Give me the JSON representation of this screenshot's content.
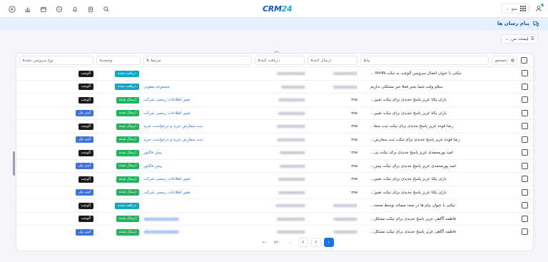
{
  "header": {
    "logo_main": "CRM",
    "logo_sub": "24",
    "app_switch_label": "منو"
  },
  "page": {
    "title": "پیام رسان ها",
    "filter_label": "لیست من"
  },
  "table": {
    "search_label": "جستجو",
    "columns": [
      "پیام",
      "ارسال کننده",
      "دریافت کننده",
      "مرتبط با",
      "وضعیت",
      "نوع سرویس دهنده"
    ],
    "rows": [
      {
        "message": "تیکتی با عنوان اتصال سرویس آلوچت به تیکت N۷۹N ...",
        "sender": "",
        "receiver_w": 40,
        "related": "",
        "status": "دریافت شده",
        "status_color": "#11a7c2",
        "type": "آلوچت",
        "type_color": "#1b1b1b"
      },
      {
        "message": "سلام وقت شما بخیر فعلا خبر مشکلی نداریم",
        "sender": "",
        "receiver_w": 34,
        "related": "مجموعه یعقوبی",
        "status": "دریافت شده",
        "status_color": "#11a7c2",
        "type": "آلوچت",
        "type_color": "#1b1b1b"
      },
      {
        "message": "باران یکتا عزیز پاسخ جدیدی برای تیکت تغییر...",
        "sender": "me",
        "receiver_w": 38,
        "related": "تغییر اطلاعات رسمی شرکت",
        "status": "ارسال شده",
        "status_color": "#22b35e",
        "type": "آلوچت",
        "type_color": "#1b1b1b"
      },
      {
        "message": "باران یکتا عزیز پاسخ جدیدی برای تیکت تغییر...",
        "sender": "me",
        "receiver_w": 38,
        "related": "تغییر اطلاعات رسمی شرکت",
        "status": "ارسال شده",
        "status_color": "#22b35e",
        "type": "آیپی پنل",
        "type_color": "#3f74d6"
      },
      {
        "message": "رضا قوده عزیز پاسخ جدیدی برای تیکت ثبت سفا...",
        "sender": "me",
        "receiver_w": 40,
        "related": "ثبت سفارش خرید و درخواست خرید",
        "status": "ارسال شده",
        "status_color": "#22b35e",
        "type": "آلوچت",
        "type_color": "#1b1b1b"
      },
      {
        "message": "رضا قوده عزیز پاسخ جدیدی برای تیکت ثبت سفارش...",
        "sender": "me",
        "receiver_w": 40,
        "related": "ثبت سفارش خرید و درخواست خرید",
        "status": "ارسال شده",
        "status_color": "#22b35e",
        "type": "آیپی پنل",
        "type_color": "#3f74d6"
      },
      {
        "message": "امید پورمحمدی عزیز پاسخ جدیدی برای تیکت پی...",
        "sender": "me",
        "receiver_w": 36,
        "related": "پیش فاکتور",
        "status": "ارسال شده",
        "status_color": "#22b35e",
        "type": "آلوچت",
        "type_color": "#1b1b1b"
      },
      {
        "message": "امید پورمحمدی عزیز پاسخ جدیدی برای تیکت پیش...",
        "sender": "me",
        "receiver_w": 36,
        "related": "پیش فاکتور",
        "status": "ارسال شده",
        "status_color": "#22b35e",
        "type": "آیپی پنل",
        "type_color": "#3f74d6"
      },
      {
        "message": "باران یکتا عزیز پاسخ جدیدی برای تیکت تغییر...",
        "sender": "me",
        "receiver_w": 38,
        "related": "تغییر اطلاعات رسمی شرکت",
        "status": "ارسال شده",
        "status_color": "#22b35e",
        "type": "آلوچت",
        "type_color": "#1b1b1b"
      },
      {
        "message": "باران یکتا عزیز پاسخ جدیدی برای تیکت تغییر...",
        "sender": "me",
        "receiver_w": 38,
        "related": "تغییر اطلاعات رسمی شرکت",
        "status": "ارسال شده",
        "status_color": "#22b35e",
        "type": "آیپی پنل",
        "type_color": "#3f74d6"
      },
      {
        "message": "تیکتی با عنوان پیام ها در صف میماند توسط محمد...",
        "sender": "",
        "receiver_w": 42,
        "related": "",
        "status": "دریافت شده",
        "status_color": "#11a7c2",
        "type": "آلوچت",
        "type_color": "#1b1b1b"
      },
      {
        "message": "فاطمه آگاهی عزیز پاسخ جدیدی برای تیکت مشکل...",
        "sender": "",
        "receiver_w": 40,
        "related": "",
        "status": "ارسال شده",
        "status_color": "#22b35e",
        "type": "آلوچت",
        "type_color": "#1b1b1b"
      },
      {
        "message": "فاطمه آگاهی عزیز پاسخ جدیدی برای تیکت مشکل...",
        "sender": "",
        "receiver_w": 40,
        "related": "",
        "status": "ارسال شده",
        "status_color": "#22b35e",
        "type": "آیپی پنل",
        "type_color": "#3f74d6"
      }
    ]
  },
  "pagination": {
    "pages": [
      "۱",
      "۲",
      "۳"
    ],
    "ellipsis": "...",
    "last_page": "۸۲۰",
    "next_arrow": "←"
  }
}
